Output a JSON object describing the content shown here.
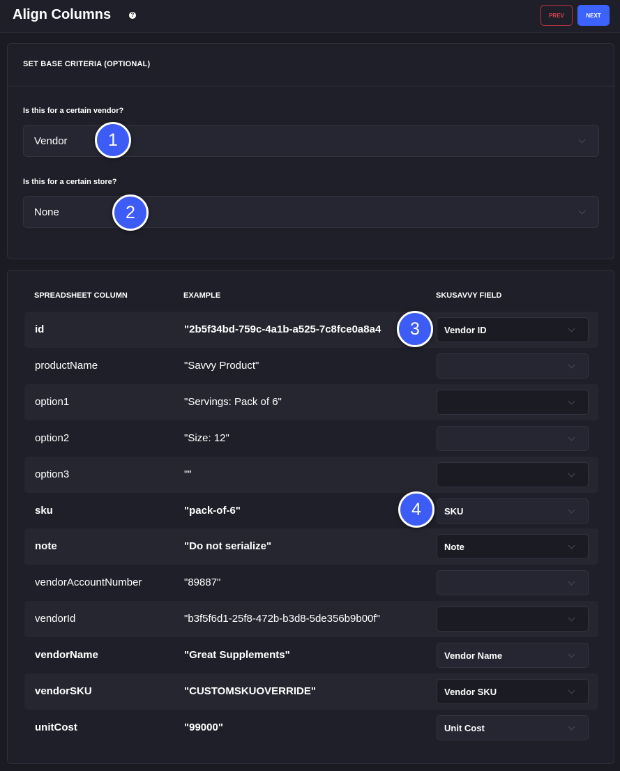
{
  "header": {
    "title": "Align Columns",
    "help_icon": "?",
    "prev_label": "PREV",
    "next_label": "NEXT"
  },
  "criteria": {
    "heading": "SET BASE CRITERIA (OPTIONAL)",
    "vendor_label": "Is this for a certain vendor?",
    "vendor_value": "Vendor",
    "store_label": "Is this for a certain store?",
    "store_value": "None"
  },
  "table": {
    "headers": [
      "SPREADSHEET COLUMN",
      "EXAMPLE",
      "SKUSAVVY FIELD"
    ],
    "rows": [
      {
        "column": "id",
        "example": "\"2b5f34bd-759c-4a1b-a525-7c8fce0a8a4",
        "field": "Vendor ID"
      },
      {
        "column": "productName",
        "example": "\"Savvy Product\"",
        "field": ""
      },
      {
        "column": "option1",
        "example": "\"Servings: Pack of 6\"",
        "field": ""
      },
      {
        "column": "option2",
        "example": "\"Size: 12\"",
        "field": ""
      },
      {
        "column": "option3",
        "example": "\"\"",
        "field": ""
      },
      {
        "column": "sku",
        "example": "\"pack-of-6\"",
        "field": "SKU"
      },
      {
        "column": "note",
        "example": "\"Do not serialize\"",
        "field": "Note"
      },
      {
        "column": "vendorAccountNumber",
        "example": "\"89887\"",
        "field": ""
      },
      {
        "column": "vendorId",
        "example": "\"b3f5f6d1-25f8-472b-b3d8-5de356b9b00f\"",
        "field": ""
      },
      {
        "column": "vendorName",
        "example": "\"Great Supplements\"",
        "field": "Vendor Name"
      },
      {
        "column": "vendorSKU",
        "example": "\"CUSTOMSKUOVERRIDE\"",
        "field": "Vendor SKU"
      },
      {
        "column": "unitCost",
        "example": "\"99000\"",
        "field": "Unit Cost"
      }
    ]
  },
  "badges": [
    "1",
    "2",
    "3",
    "4"
  ],
  "colors": {
    "background": "#1b1b24",
    "panel": "#1f1f29",
    "accent": "#3d63ff",
    "prev_border": "#b8323f",
    "badge": "#3d5cf5"
  }
}
